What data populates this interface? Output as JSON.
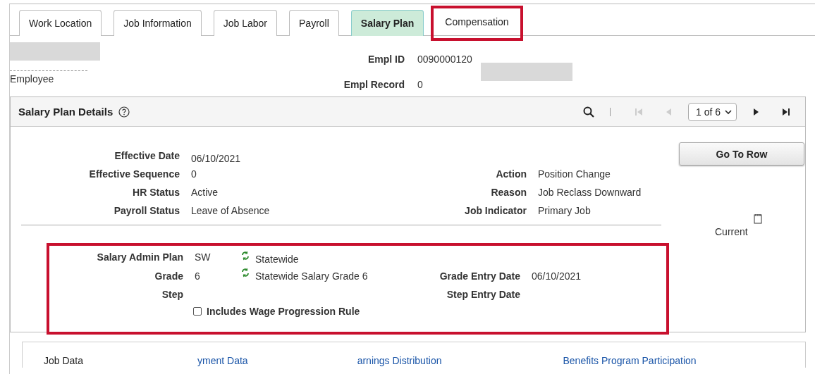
{
  "tabs": [
    {
      "label": "Work Location",
      "selected": false,
      "highlighted": false
    },
    {
      "label": "Job Information",
      "selected": false,
      "highlighted": false
    },
    {
      "label": "Job Labor",
      "selected": false,
      "highlighted": false
    },
    {
      "label": "Payroll",
      "selected": false,
      "highlighted": false
    },
    {
      "label": "Salary Plan",
      "selected": true,
      "highlighted": false
    },
    {
      "label": "Compensation",
      "selected": false,
      "highlighted": true
    }
  ],
  "employee": {
    "label": "Employee",
    "empl_id_label": "Empl ID",
    "empl_id": "0090000120",
    "empl_record_label": "Empl Record",
    "empl_record": "0"
  },
  "section": {
    "title": "Salary Plan Details",
    "counter": "1 of 6",
    "nav": [
      {
        "kind": "first",
        "disabled": true
      },
      {
        "kind": "prev",
        "disabled": true
      },
      {
        "kind": "next",
        "disabled": false
      },
      {
        "kind": "last",
        "disabled": false
      }
    ],
    "go_to_row": "Go To Row",
    "current": "Current",
    "fields": [
      {
        "label": "Effective Date",
        "value": "06/10/2021"
      },
      {
        "label": "Effective Sequence",
        "value": "0",
        "right_label": "Action",
        "right_value": "Position Change"
      },
      {
        "label": "HR Status",
        "value": "Active",
        "right_label": "Reason",
        "right_value": "Job Reclass Downward"
      },
      {
        "label": "Payroll Status",
        "value": "Leave of Absence",
        "right_label": "Job Indicator",
        "right_value": "Primary Job"
      }
    ]
  },
  "salary_plan": {
    "highlighted": true,
    "admin_plan_label": "Salary Admin Plan",
    "admin_plan": "SW",
    "admin_plan_desc": "Statewide",
    "grade_label": "Grade",
    "grade": "6",
    "grade_desc": "Statewide Salary Grade 6",
    "grade_entry_label": "Grade Entry Date",
    "grade_entry": "06/10/2021",
    "step_label": "Step",
    "step_entry_label": "Step Entry Date",
    "wage_rule": {
      "label": "Includes Wage Progression Rule",
      "checked": false
    }
  },
  "bottom_links": [
    "Job Data",
    "yment Data",
    "arnings Distribution",
    "Benefits Program Participation"
  ]
}
